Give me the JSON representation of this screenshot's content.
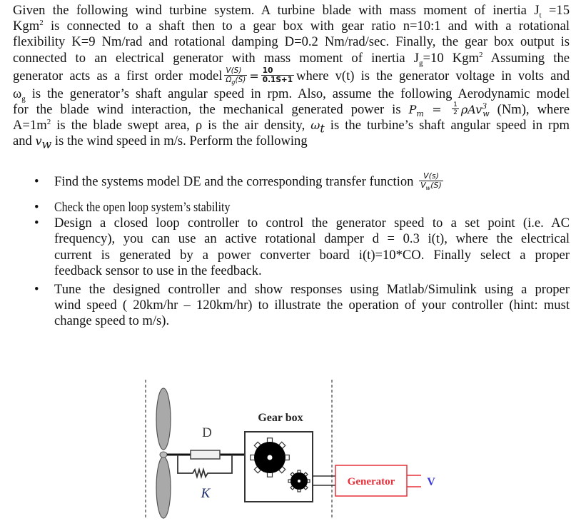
{
  "paragraph": {
    "lines": [
      "Given the following wind turbine system. A turbine blade with mass moment of inertia J",
      "Kgm",
      "flexibility K=9 Nm/rad  and rotational damping D=0.2 Nm/rad/sec. Finally, the gear box output is",
      "connected to an electrical generator with mass moment of inertia J",
      "generator acts as a first order model",
      "is the generator’s shaft angular speed in rpm. Also, assume the following Aerodynamic model",
      "for the blade wind interaction, the mechanical generated power is",
      "A=1m",
      "and",
      "is the wind speed in m/s. Perform the following"
    ],
    "line1": {
      "pre": "Given the following wind turbine system. A turbine blade with mass moment of inertia J",
      "sub": "t",
      "post": " =15"
    },
    "line2": {
      "pre": "Kgm",
      "sup": "2",
      "post": " is connected to a shaft then to a gear box with gear ratio n=10:1 and with a rotational"
    },
    "line3": "flexibility K=9 Nm/rad  and rotational damping D=0.2 Nm/rad/sec. Finally, the gear box output is",
    "line4": {
      "pre": "connected to an electrical generator with mass moment of inertia J",
      "sub": "g",
      "mid": "=10 Kgm",
      "sup": "2",
      "post": " Assuming the"
    },
    "line5": {
      "pre": "generator acts as a first order model",
      "frac1_num": "V(S)",
      "frac1_den": "Ω",
      "frac1_den_sub": "g",
      "frac1_den_post": "(S)",
      "eq": "=",
      "frac2_num": "10",
      "frac2_den": "0.1S+1",
      "post": "where v(t) is the generator voltage in volts and"
    },
    "line6": {
      "sym": "ω",
      "sub": "g",
      "post": " is the generator’s shaft angular speed in rpm. Also, assume the following Aerodynamic model"
    },
    "line7": {
      "pre": "for the blade wind interaction, the mechanical generated power is",
      "eq_lhs": "P",
      "eq_lhs_sub": "m",
      "eq_mid": " = ",
      "half_num": "1",
      "half_den": "2",
      "eq_rhs": "ρAv",
      "eq_rhs_sup": "3",
      "eq_rhs_sub": "w",
      "post": "(Nm),  where"
    },
    "line8": {
      "pre": "A=1m",
      "sup": "2",
      "mid": " is the blade swept area, ρ is the air density, ",
      "sym": "ω",
      "sym_sub": "t",
      "post": " is the turbine’s shaft angular speed in rpm"
    },
    "line9": {
      "pre": "and ",
      "sym": "v",
      "sym_sub": "w",
      "post": " is the wind speed in m/s. Perform the following"
    }
  },
  "tasks": [
    {
      "text": "Find the systems model DE and the corresponding transfer function",
      "frac_num": "V(s)",
      "frac_den": "V",
      "frac_den_sub": "w",
      "frac_den_post": "(S)"
    },
    {
      "text": "Check the open loop system’s stability"
    },
    {
      "lines": [
        "Design a closed loop controller to control the generator speed to a set point (i.e. AC",
        "frequency), you can use an active rotational damper d = 0.3 i(t), where the electrical",
        "current is generated by a power converter board i(t)=10*CO. Finally select a proper",
        "feedback sensor to use in the feedback."
      ]
    },
    {
      "lines": [
        "Tune the designed controller and show responses using Matlab/Simulink using a proper",
        "wind speed ( 20km/hr – 120km/hr) to illustrate the operation of your controller  (hint: must",
        "change speed to m/s)."
      ]
    }
  ],
  "bullet_glyph": "•",
  "diagram": {
    "damper_label": "D",
    "spring_label": "K",
    "gearbox_label": "Gear box",
    "generator_label": "Generator",
    "output_label": "V",
    "colors": {
      "blade_fill": "#a9a9a9",
      "line": "#333333",
      "dashed": "#888888",
      "generator": "#e8303a",
      "output_label": "#3a3ad8",
      "damper_label": "#c87a2a",
      "spring_label": "#1a2a6a"
    }
  }
}
